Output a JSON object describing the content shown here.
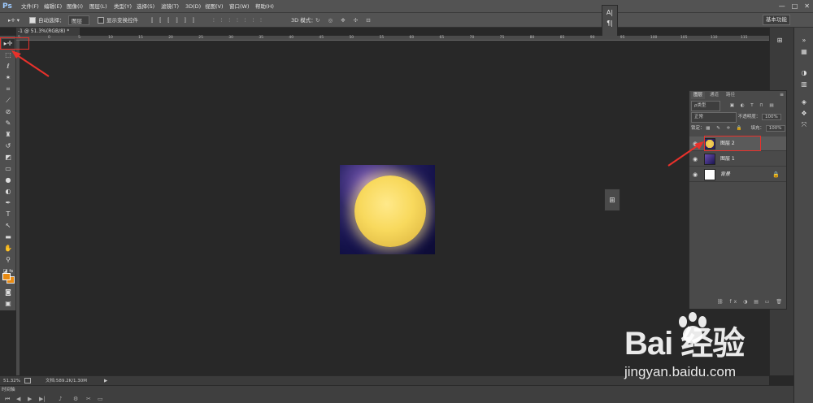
{
  "app": {
    "logo": "Ps"
  },
  "menu": [
    "文件(F)",
    "编辑(E)",
    "图像(I)",
    "图层(L)",
    "类型(Y)",
    "选择(S)",
    "滤镜(T)",
    "3D(D)",
    "视图(V)",
    "窗口(W)",
    "帮助(H)"
  ],
  "window_controls": [
    "—",
    "□",
    "✕"
  ],
  "options": {
    "auto_select_label": "自动选择：",
    "auto_select_value": "图层",
    "show_transform_label": "显示变换控件",
    "mode_3d_label": "3D 模式：",
    "workspace": "基本功能"
  },
  "char_panel": {
    "a": "A|",
    "p": "¶|"
  },
  "document": {
    "tab": "-1 @ 51.3%(RGB/8) *"
  },
  "ruler_ticks": [
    "5",
    "0",
    "5",
    "10",
    "15",
    "20",
    "25",
    "30",
    "35",
    "40",
    "45",
    "50",
    "55",
    "60",
    "65",
    "70",
    "75",
    "80",
    "85",
    "90",
    "95",
    "100",
    "105",
    "110",
    "115"
  ],
  "layers_panel": {
    "tabs": [
      "图层",
      "通道",
      "路径"
    ],
    "filter_label": "ρ类型",
    "blend_mode": "正常",
    "opacity_label": "不透明度：",
    "opacity_value": "100%",
    "lock_label": "锁定：",
    "fill_label": "填充：",
    "fill_value": "100%",
    "layers": [
      {
        "name": "图层 2",
        "thumb": "moon",
        "selected": true
      },
      {
        "name": "图层 1",
        "thumb": "sky",
        "selected": false
      },
      {
        "name": "背景",
        "thumb": "white",
        "selected": false,
        "locked": true
      }
    ]
  },
  "status": {
    "zoom": "51.32%",
    "doc_info": "文档:589.2K/1.30M",
    "arrow": "▶"
  },
  "timeline": {
    "tab": "时间轴"
  },
  "watermark": {
    "logo": "Bai  经验",
    "url": "jingyan.baidu.com"
  },
  "colors": {
    "highlight": "#e8312b",
    "foreground": "#e88a12",
    "background": "#e88a12"
  }
}
